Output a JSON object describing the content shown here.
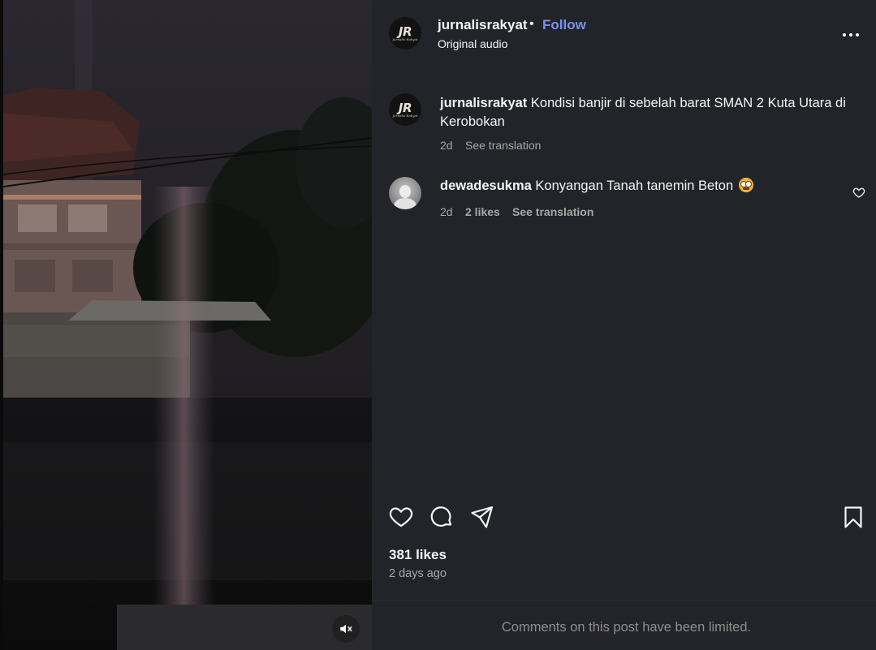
{
  "post": {
    "username": "jurnalisrakyat",
    "separator": "•",
    "follow_label": "Follow",
    "audio_label": "Original audio",
    "avatar_initials": "JR",
    "avatar_subtext": "Jurnalis Rakyat"
  },
  "caption": {
    "username": "jurnalisrakyat",
    "text": "Kondisi banjir di sebelah barat SMAN 2 Kuta Utara di Kerobokan",
    "time": "2d",
    "translate_label": "See translation"
  },
  "comments": [
    {
      "username": "dewadesukma",
      "text": "Konyangan Tanah tanemin Beton",
      "emoji": "flushed-face-emoji",
      "time": "2d",
      "likes_label": "2 likes",
      "translate_label": "See translation"
    }
  ],
  "actions": {
    "like_icon": "heart-icon",
    "comment_icon": "comment-icon",
    "share_icon": "send-icon",
    "save_icon": "bookmark-icon"
  },
  "stats": {
    "likes_label": "381 likes",
    "posted_ago": "2 days ago"
  },
  "footer": {
    "comments_limited": "Comments on this post have been limited."
  },
  "video": {
    "mute_icon": "speaker-muted-icon"
  },
  "colors": {
    "panel_bg": "#232429",
    "link_blue": "#7b8ff5",
    "muted_text": "#a8a8a8"
  }
}
